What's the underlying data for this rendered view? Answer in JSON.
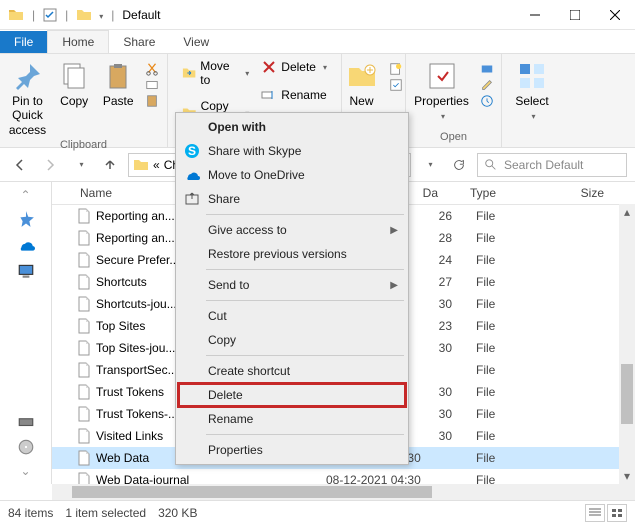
{
  "window": {
    "title": "Default"
  },
  "tabs": {
    "file": "File",
    "home": "Home",
    "share": "Share",
    "view": "View"
  },
  "ribbon": {
    "pin": "Pin to Quick\naccess",
    "copy": "Copy",
    "paste": "Paste",
    "clipboard_label": "Clipboard",
    "moveto": "Move to",
    "copyto": "Copy to",
    "delete": "Delete",
    "rename": "Rename",
    "new": "New",
    "properties": "Properties",
    "open_label": "Open",
    "select": "Select"
  },
  "address": {
    "crumb1": "Chr",
    "search_placeholder": "Search Default"
  },
  "columns": {
    "name": "Name",
    "date": "Da",
    "type": "Type",
    "size": "Size"
  },
  "files": [
    {
      "name": "Reporting an...",
      "date": "26",
      "type": "File",
      "truncated": true
    },
    {
      "name": "Reporting an...",
      "date": "28",
      "type": "File",
      "truncated": true
    },
    {
      "name": "Secure Prefer...",
      "date": "24",
      "type": "File",
      "truncated": true
    },
    {
      "name": "Shortcuts",
      "date": "27",
      "type": "File",
      "truncated": true
    },
    {
      "name": "Shortcuts-jou...",
      "date": "30",
      "type": "File",
      "truncated": true
    },
    {
      "name": "Top Sites",
      "date": "23",
      "type": "File",
      "truncated": true
    },
    {
      "name": "Top Sites-jou...",
      "date": "30",
      "type": "File",
      "truncated": true
    },
    {
      "name": "TransportSec...",
      "date": "",
      "type": "File",
      "truncated": true
    },
    {
      "name": "Trust Tokens",
      "date": "30",
      "type": "File",
      "truncated": true
    },
    {
      "name": "Trust Tokens-...",
      "date": "30",
      "type": "File",
      "truncated": true
    },
    {
      "name": "Visited Links",
      "date": "30",
      "type": "File",
      "truncated": true
    },
    {
      "name": "Web Data",
      "date": "08-12-2021 04:30",
      "type": "File",
      "selected": true
    },
    {
      "name": "Web Data-journal",
      "date": "08-12-2021 04:30",
      "type": "File"
    }
  ],
  "context_menu": {
    "open_with": "Open with",
    "skype": "Share with Skype",
    "onedrive": "Move to OneDrive",
    "share": "Share",
    "give_access": "Give access to",
    "restore": "Restore previous versions",
    "send_to": "Send to",
    "cut": "Cut",
    "copy": "Copy",
    "shortcut": "Create shortcut",
    "delete": "Delete",
    "rename": "Rename",
    "properties": "Properties"
  },
  "status": {
    "items": "84 items",
    "selected": "1 item selected",
    "size": "320 KB"
  }
}
